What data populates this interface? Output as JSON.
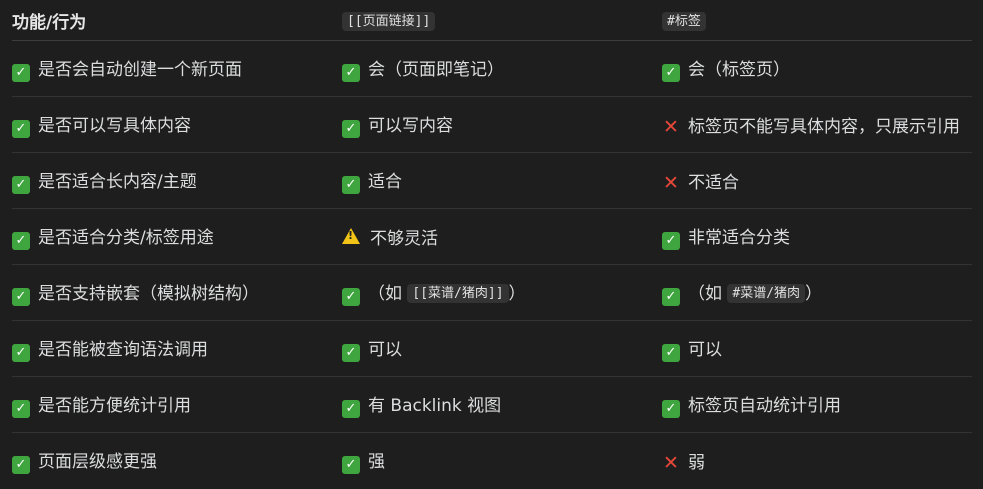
{
  "header": {
    "col1": "功能/行为",
    "col2": "[[页面链接]]",
    "col3": "#标签"
  },
  "rows": [
    {
      "feature": "是否会自动创建一个新页面",
      "c2_icon": "check-icon",
      "c2_pre": "会（页面即笔记）",
      "c2_code": "",
      "c2_post": "",
      "c3_icon": "check-icon",
      "c3_pre": "会（标签页）",
      "c3_code": "",
      "c3_post": ""
    },
    {
      "feature": "是否可以写具体内容",
      "c2_icon": "check-icon",
      "c2_pre": "可以写内容",
      "c2_code": "",
      "c2_post": "",
      "c3_icon": "cross-icon",
      "c3_pre": "标签页不能写具体内容，只展示引用",
      "c3_code": "",
      "c3_post": ""
    },
    {
      "feature": "是否适合长内容/主题",
      "c2_icon": "check-icon",
      "c2_pre": "适合",
      "c2_code": "",
      "c2_post": "",
      "c3_icon": "cross-icon",
      "c3_pre": "不适合",
      "c3_code": "",
      "c3_post": ""
    },
    {
      "feature": "是否适合分类/标签用途",
      "c2_icon": "warning-icon",
      "c2_pre": "不够灵活",
      "c2_code": "",
      "c2_post": "",
      "c3_icon": "check-icon",
      "c3_pre": "非常适合分类",
      "c3_code": "",
      "c3_post": ""
    },
    {
      "feature": "是否支持嵌套（模拟树结构）",
      "c2_icon": "check-icon",
      "c2_pre": "（如 ",
      "c2_code": "[[菜谱/猪肉]]",
      "c2_post": "）",
      "c3_icon": "check-icon",
      "c3_pre": "（如 ",
      "c3_code": "#菜谱/猪肉",
      "c3_post": "）"
    },
    {
      "feature": "是否能被查询语法调用",
      "c2_icon": "check-icon",
      "c2_pre": "可以",
      "c2_code": "",
      "c2_post": "",
      "c3_icon": "check-icon",
      "c3_pre": "可以",
      "c3_code": "",
      "c3_post": ""
    },
    {
      "feature": "是否能方便统计引用",
      "c2_icon": "check-icon",
      "c2_pre": "有 Backlink 视图",
      "c2_code": "",
      "c2_post": "",
      "c3_icon": "check-icon",
      "c3_pre": "标签页自动统计引用",
      "c3_code": "",
      "c3_post": ""
    },
    {
      "feature": "页面层级感更强",
      "c2_icon": "check-icon",
      "c2_pre": "强",
      "c2_code": "",
      "c2_post": "",
      "c3_icon": "cross-icon",
      "c3_pre": "弱",
      "c3_code": "",
      "c3_post": ""
    }
  ],
  "colors": {
    "check": "#3fa53f",
    "cross": "#e5483a",
    "warning": "#f2c417",
    "background": "#1e1e1e",
    "text": "#dcddde"
  }
}
